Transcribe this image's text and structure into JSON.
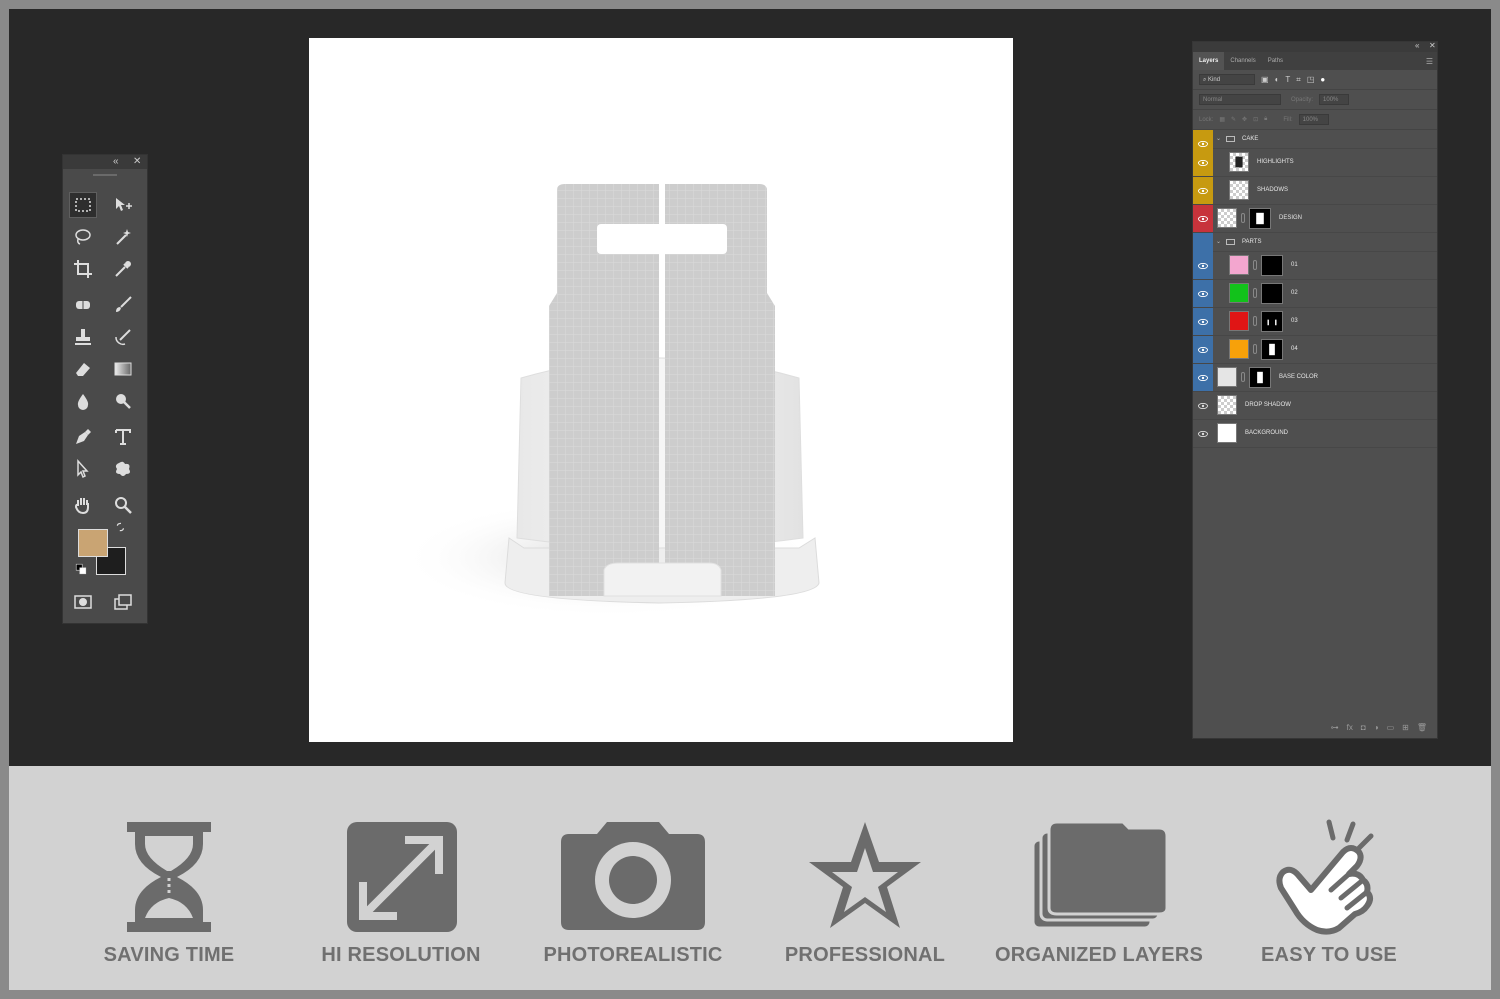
{
  "colors": {
    "foreground_swatch": "#c9a473",
    "background_swatch": "#1e1e1e",
    "cake_group": "#c79a10",
    "design_layer": "#c7333b",
    "parts_group": "#3d70a8",
    "feature_icon": "#6b6b6b",
    "feature_text": "#707070"
  },
  "tools_panel": {
    "collapse_glyph": "«",
    "close_glyph": "✕",
    "tools": [
      "rectangular-marquee",
      "move",
      "lasso",
      "magic-wand",
      "crop",
      "eyedropper",
      "healing-brush",
      "brush",
      "clone-stamp",
      "history-brush",
      "eraser",
      "gradient",
      "blur",
      "dodge",
      "pen",
      "type",
      "path-selection",
      "custom-shape",
      "hand",
      "zoom"
    ]
  },
  "layers_panel": {
    "collapse_glyph": "«",
    "close_glyph": "✕",
    "menu_glyph": "☰",
    "tabs": [
      "Layers",
      "Channels",
      "Paths"
    ],
    "active_tab": "Layers",
    "filter_kind": "Kind",
    "blend_mode": "Normal",
    "opacity_label": "Opacity:",
    "opacity_value": "100%",
    "lock_label": "Lock:",
    "fill_label": "Fill:",
    "fill_value": "100%",
    "layers": [
      {
        "name": "CAKE",
        "kind": "group",
        "color": "#c79a10"
      },
      {
        "name": "HIGHLIGHTS",
        "kind": "layer",
        "color": "#c79a10"
      },
      {
        "name": "SHADOWS",
        "kind": "layer",
        "color": "#c79a10"
      },
      {
        "name": "DESIGN",
        "kind": "smart",
        "color": "#c7333b"
      },
      {
        "name": "PARTS",
        "kind": "group",
        "color": "#3d70a8"
      },
      {
        "name": "01",
        "kind": "fill",
        "swatch": "#f3a6cf",
        "color": "#3d70a8"
      },
      {
        "name": "02",
        "kind": "fill",
        "swatch": "#12c21b",
        "color": "#3d70a8"
      },
      {
        "name": "03",
        "kind": "fill",
        "swatch": "#e01515",
        "color": "#3d70a8"
      },
      {
        "name": "04",
        "kind": "fill",
        "swatch": "#f7a10a",
        "color": "#3d70a8"
      },
      {
        "name": "BASE COLOR",
        "kind": "fill",
        "swatch": "#e5e5e5",
        "color": "#3d70a8"
      },
      {
        "name": "DROP SHADOW",
        "kind": "layer",
        "color": ""
      },
      {
        "name": "BACKGROUND",
        "kind": "white",
        "color": ""
      }
    ]
  },
  "features": [
    {
      "label": "SAVING TIME",
      "icon": "hourglass-icon"
    },
    {
      "label": "HI RESOLUTION",
      "icon": "expand-arrows-icon"
    },
    {
      "label": "PHOTOREALISTIC",
      "icon": "camera-icon"
    },
    {
      "label": "PROFESSIONAL",
      "icon": "star-icon"
    },
    {
      "label": "ORGANIZED LAYERS",
      "icon": "stacked-folders-icon"
    },
    {
      "label": "EASY TO USE",
      "icon": "tap-hand-icon"
    }
  ]
}
